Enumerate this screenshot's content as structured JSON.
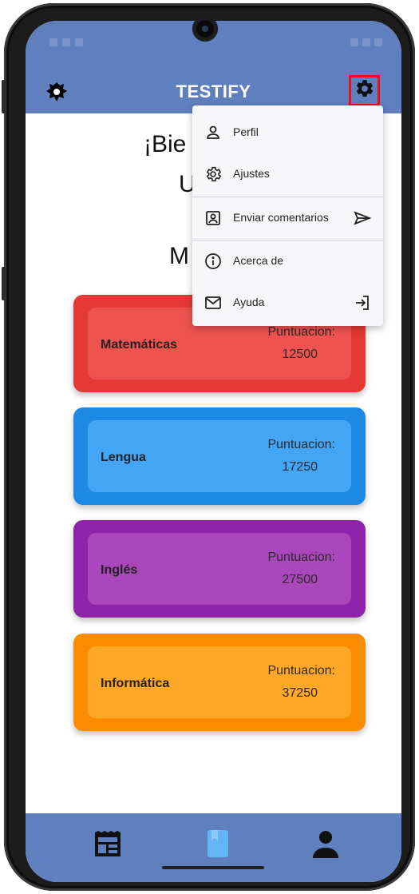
{
  "app": {
    "title": "TESTIFY"
  },
  "welcome": {
    "greeting_partial": "¡Bie",
    "user_partial": "U",
    "section_partial": "M"
  },
  "subjects": [
    {
      "name": "Matemáticas",
      "score_label": "Puntuacion:",
      "score": "12500",
      "outer_color": "#e53935",
      "inner_color": "#ef5350"
    },
    {
      "name": "Lengua",
      "score_label": "Puntuacion:",
      "score": "17250",
      "outer_color": "#1e88e5",
      "inner_color": "#42a5f5"
    },
    {
      "name": "Inglés",
      "score_label": "Puntuacion:",
      "score": "27500",
      "outer_color": "#8e24aa",
      "inner_color": "#ab47bc"
    },
    {
      "name": "Informática",
      "score_label": "Puntuacion:",
      "score": "37250",
      "outer_color": "#fb8c00",
      "inner_color": "#ffa726"
    }
  ],
  "menu": {
    "items": [
      {
        "label": "Perfil",
        "icon": "person-icon"
      },
      {
        "label": "Ajustes",
        "icon": "settings-outline-icon"
      },
      {
        "label": "Enviar comentarios",
        "icon": "account-box-icon",
        "trailing_icon": "send-icon"
      },
      {
        "label": "Acerca de",
        "icon": "info-icon"
      },
      {
        "label": "Ayuda",
        "icon": "mail-icon",
        "trailing_icon": "login-icon"
      }
    ]
  },
  "colors": {
    "primary": "#5f7fbf",
    "accent_red": "#e8101a",
    "nav_active": "#64b5f6"
  },
  "bottom_nav": [
    {
      "icon": "newspaper-icon",
      "active": false
    },
    {
      "icon": "book-icon",
      "active": true
    },
    {
      "icon": "person-filled-icon",
      "active": false
    }
  ]
}
